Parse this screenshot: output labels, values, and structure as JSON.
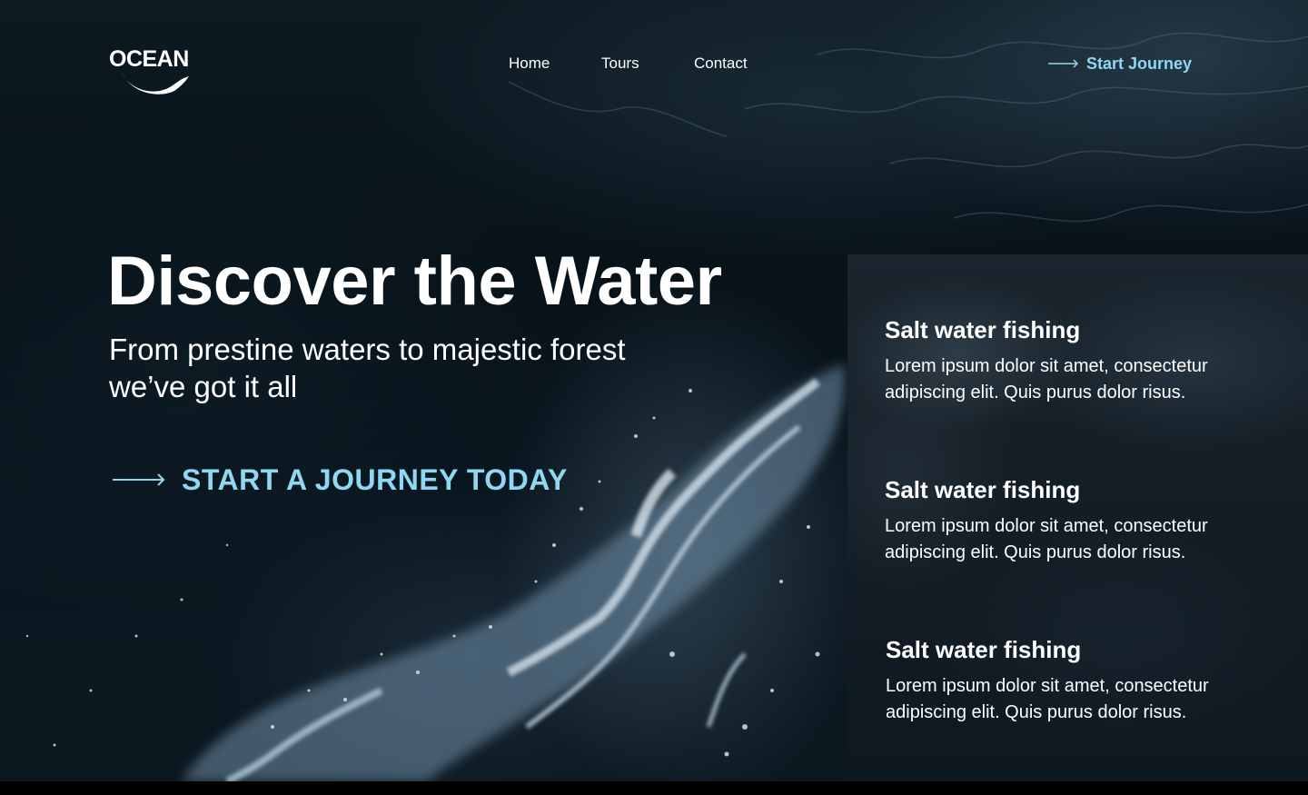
{
  "brand": {
    "logo_text": "OCEAN",
    "accent_color": "#8fd8f2"
  },
  "nav": {
    "items": [
      {
        "label": "Home"
      },
      {
        "label": "Tours"
      },
      {
        "label": "Contact"
      }
    ]
  },
  "header_cta": {
    "label": "Start Journey",
    "icon": "arrow-right-icon"
  },
  "hero": {
    "title": "Discover the Water",
    "subtitle": "From prestine waters to majestic forest we’ve got it all",
    "cta_label": "START A JOURNEY TODAY",
    "cta_icon": "arrow-right-icon"
  },
  "features": [
    {
      "title": "Salt water fishing",
      "body": "Lorem ipsum dolor sit amet, consectetur adipiscing elit. Quis purus dolor risus."
    },
    {
      "title": "Salt water fishing",
      "body": "Lorem ipsum dolor sit amet, consectetur adipiscing elit. Quis purus dolor risus."
    },
    {
      "title": "Salt water fishing",
      "body": "Lorem ipsum dolor sit amet, consectetur adipiscing elit. Quis purus dolor risus."
    }
  ]
}
